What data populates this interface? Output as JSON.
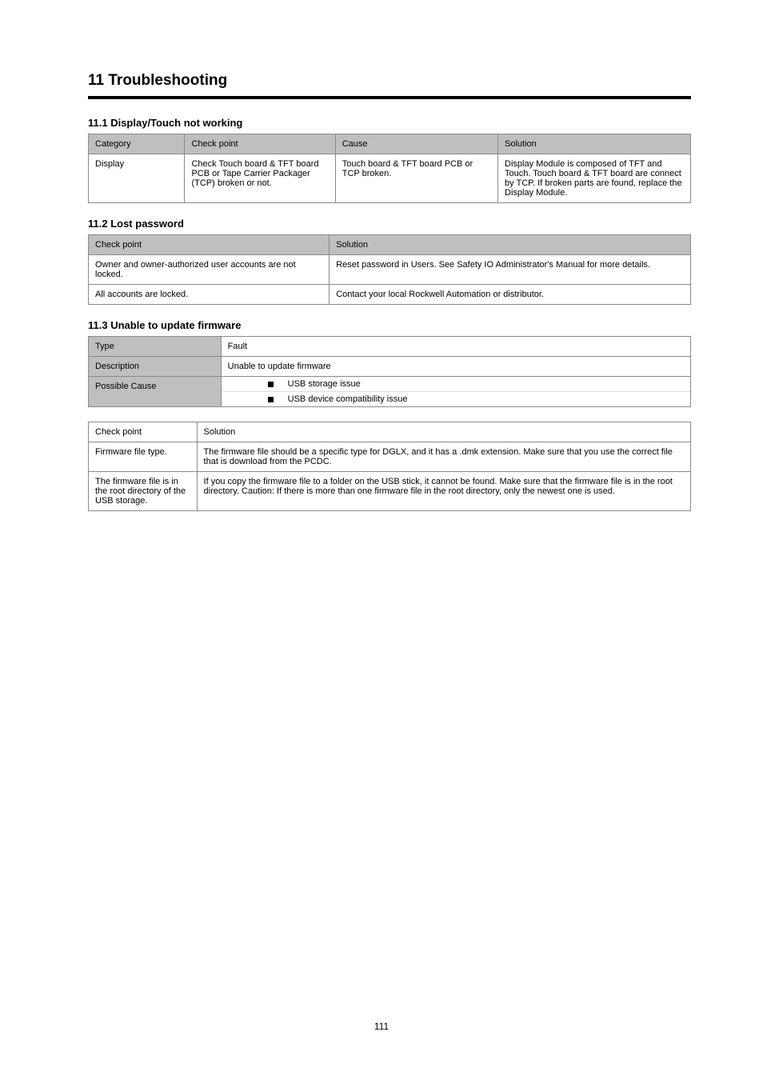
{
  "page": {
    "heading": "11 Troubleshooting",
    "number": "111"
  },
  "sections": {
    "s1": {
      "title": "11.1 Display/Touch not working",
      "headers": [
        "Category",
        "Check point",
        "Cause",
        "Solution"
      ],
      "rows": [
        [
          "Display",
          "Check Touch board & TFT board PCB or Tape Carrier Packager (TCP) broken or not.",
          "Touch board & TFT board PCB or TCP broken.",
          "Display Module is composed of TFT and Touch. Touch board & TFT board are connect by TCP. If broken parts are found, replace the Display Module."
        ]
      ]
    },
    "s2": {
      "title": "11.2 Lost password",
      "headers": [
        "Check point",
        "Solution"
      ],
      "rows": [
        [
          "Owner and owner-authorized user accounts are not locked.",
          "Reset password in Users. See Safety IO Administrator's Manual for more details."
        ],
        [
          "All accounts are locked.",
          "Contact your local Rockwell Automation or distributor."
        ]
      ]
    },
    "s3": {
      "title": "11.3 Unable to update firmware",
      "meta": {
        "type_label": "Type",
        "type_value": "Fault",
        "desc_label": "Description",
        "desc_value": "Unable to update firmware",
        "cause_label": "Possible Cause",
        "causes": [
          "USB storage issue",
          "USB device compatibility issue"
        ]
      },
      "headers": [
        "Check point",
        "Solution"
      ],
      "rows": [
        [
          "Firmware file type.",
          "The firmware file should be a specific type for DGLX, and it has a .dmk extension. Make sure that you use the correct file that is download from the PCDC."
        ],
        [
          "The firmware file is in the root directory of the USB storage.",
          "If you copy the firmware file to a folder on the USB stick, it cannot be found. Make sure that the firmware file is in the root directory. Caution: If there is more than one firmware file in the root directory, only the newest one is used."
        ]
      ]
    }
  }
}
